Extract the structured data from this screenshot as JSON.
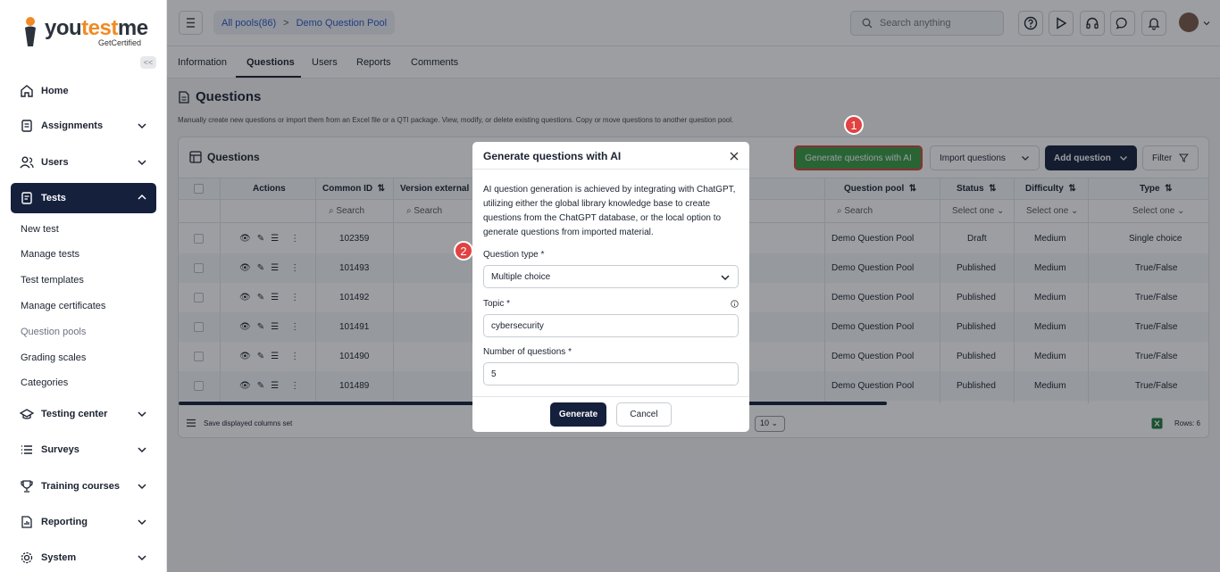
{
  "brand": {
    "name_left": "you",
    "name_test": "test",
    "name_me": "me",
    "tagline": "GetCertified"
  },
  "sidebar": {
    "items": [
      {
        "label": "Home"
      },
      {
        "label": "Assignments"
      },
      {
        "label": "Users"
      },
      {
        "label": "Tests"
      },
      {
        "label": "Testing center"
      },
      {
        "label": "Surveys"
      },
      {
        "label": "Training courses"
      },
      {
        "label": "Reporting"
      },
      {
        "label": "System"
      }
    ],
    "sub_items": [
      "New test",
      "Manage tests",
      "Test templates",
      "Manage certificates",
      "Question pools",
      "Grading scales",
      "Categories"
    ],
    "collapse_label": "<<"
  },
  "topbar": {
    "crumb_pools": "All pools(86)",
    "crumb_sep": ">",
    "crumb_current": "Demo Question Pool",
    "search_placeholder": "Search anything"
  },
  "tabs": [
    "Information",
    "Questions",
    "Users",
    "Reports",
    "Comments"
  ],
  "page": {
    "title": "Questions",
    "description": "Manually create new questions or import them from an Excel file or a QTI package. View, modify, or delete existing questions. Copy or move questions to another question pool."
  },
  "card": {
    "title": "Questions",
    "generate_label": "Generate questions with AI",
    "import_label": "Import questions",
    "add_label": "Add question",
    "filter_label": "Filter",
    "columns": {
      "actions": "Actions",
      "common_id": "Common ID",
      "version": "Version external",
      "pool": "Question pool",
      "status": "Status",
      "difficulty": "Difficulty",
      "type": "Type"
    },
    "filter_search": "Search",
    "filter_select": "Select one",
    "rows": [
      {
        "id": "102359",
        "pool": "Demo Question Pool",
        "status": "Draft",
        "difficulty": "Medium",
        "type": "Single choice"
      },
      {
        "id": "101493",
        "pool": "Demo Question Pool",
        "status": "Published",
        "difficulty": "Medium",
        "type": "True/False"
      },
      {
        "id": "101492",
        "pool": "Demo Question Pool",
        "status": "Published",
        "difficulty": "Medium",
        "type": "True/False"
      },
      {
        "id": "101491",
        "pool": "Demo Question Pool",
        "status": "Published",
        "difficulty": "Medium",
        "type": "True/False"
      },
      {
        "id": "101490",
        "pool": "Demo Question Pool",
        "status": "Published",
        "difficulty": "Medium",
        "type": "True/False"
      },
      {
        "id": "101489",
        "pool": "Demo Question Pool",
        "status": "Published",
        "difficulty": "Medium",
        "type": "True/False"
      }
    ],
    "save_columns": "Save displayed columns set",
    "page_size": "10",
    "rows_count": "Rows: 6"
  },
  "modal": {
    "title": "Generate questions with AI",
    "description": "AI question generation is achieved by integrating with ChatGPT, utilizing either the global library knowledge base to create questions from the ChatGPT database, or the local option to generate questions from imported material.",
    "question_type_label": "Question type",
    "question_type_value": "Multiple choice",
    "topic_label": "Topic",
    "topic_value": "cybersecurity",
    "number_label": "Number of questions",
    "number_value": "5",
    "required_mark": "*",
    "generate_label": "Generate",
    "cancel_label": "Cancel"
  },
  "markers": [
    "1",
    "2"
  ],
  "colors": {
    "accent": "#15203d",
    "generate_green": "#3a9c46",
    "highlight_red": "#e14242",
    "logo_orange": "#f08a24",
    "link_blue": "#2a56c6"
  }
}
